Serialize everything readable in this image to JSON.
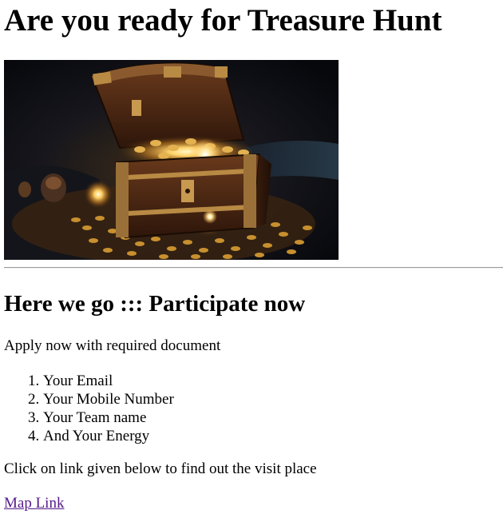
{
  "header": {
    "title": "Are you ready for Treasure Hunt"
  },
  "hero": {
    "icon": "treasure-chest-image"
  },
  "section": {
    "heading": "Here we go ::: Participate now",
    "intro": "Apply now with required document",
    "requirements": [
      "Your Email",
      "Your Mobile Number",
      "Your Team name",
      "And Your Energy"
    ],
    "instruction": "Click on link given below to find out the visit place",
    "link_label": "Map Link"
  },
  "colors": {
    "visited_link": "#551a8b",
    "text": "#000000",
    "background": "#ffffff"
  }
}
